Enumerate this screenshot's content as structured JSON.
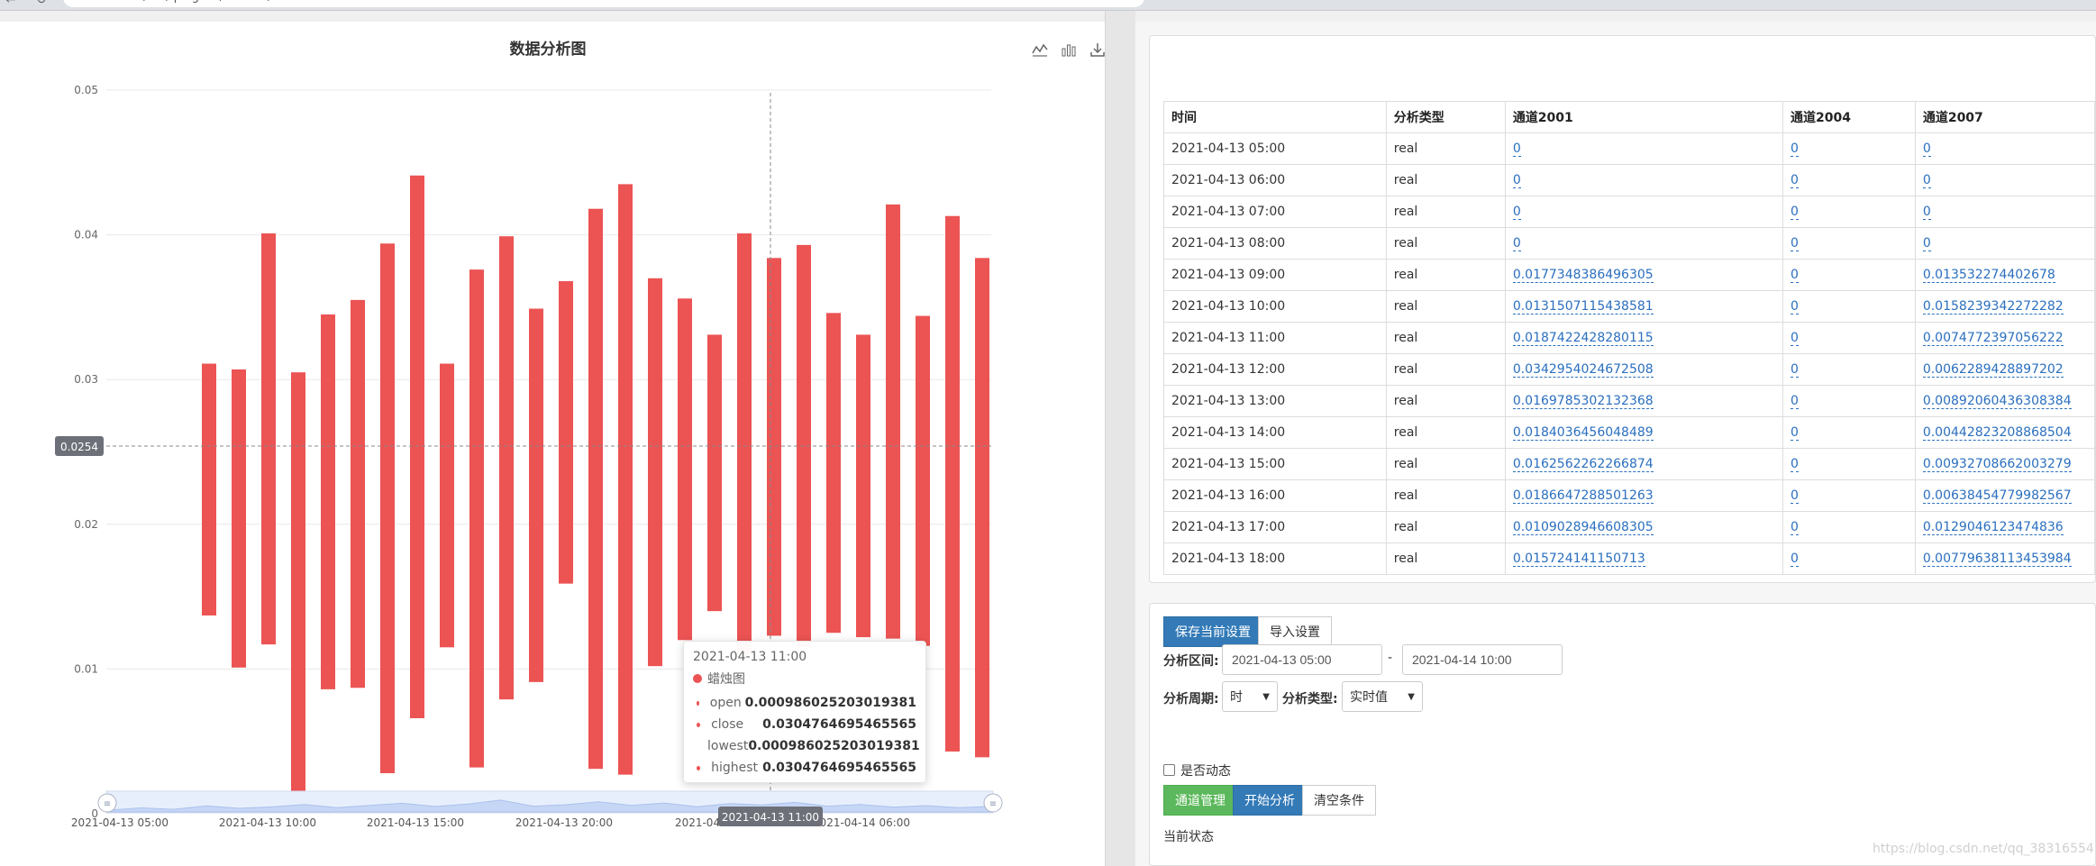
{
  "browser": {
    "url": "localhost:8 / ... / plugins / charts / ...",
    "back_glyph": "←",
    "reload_glyph": "↻"
  },
  "chart": {
    "title": "数据分析图",
    "toolbox": [
      "line-chart-icon",
      "bar-chart-icon",
      "download-icon"
    ],
    "crosshair_y_label": "0.0254",
    "crosshair_x_label": "2021-04-13 11:00",
    "zoom_handles": [
      "zoom-handle-left",
      "zoom-handle-right"
    ],
    "zero_label": "0"
  },
  "chart_data": {
    "type": "candlestick",
    "title": "数据分析图",
    "series_name": "蜡烛图",
    "ylim": [
      0,
      0.05
    ],
    "y_ticks": [
      "0.05",
      "0.04",
      "0.03",
      "0.02",
      "0.01"
    ],
    "x_tick_labels": [
      "2021-04-13 05:00",
      "2021-04-13 10:00",
      "2021-04-13 15:00",
      "2021-04-13 20:00",
      "2021-04-1",
      "2021-04-14 06:00"
    ],
    "color": "#ec5353",
    "candles": [
      {
        "low": 0.0137,
        "high": 0.0311
      },
      {
        "low": 0.0101,
        "high": 0.0307
      },
      {
        "low": 0.0117,
        "high": 0.0401
      },
      {
        "low": 0.001,
        "high": 0.0305
      },
      {
        "low": 0.0086,
        "high": 0.0345
      },
      {
        "low": 0.0087,
        "high": 0.0355
      },
      {
        "low": 0.0028,
        "high": 0.0394
      },
      {
        "low": 0.0066,
        "high": 0.0441
      },
      {
        "low": 0.0115,
        "high": 0.0311
      },
      {
        "low": 0.0032,
        "high": 0.0376
      },
      {
        "low": 0.0079,
        "high": 0.0399
      },
      {
        "low": 0.0091,
        "high": 0.0349
      },
      {
        "low": 0.0159,
        "high": 0.0368
      },
      {
        "low": 0.0031,
        "high": 0.0418
      },
      {
        "low": 0.0027,
        "high": 0.0435
      },
      {
        "low": 0.0102,
        "high": 0.037
      },
      {
        "low": 0.012,
        "high": 0.0356
      },
      {
        "low": 0.014,
        "high": 0.0331
      },
      {
        "low": 0.011,
        "high": 0.0401
      },
      {
        "low": 0.0123,
        "high": 0.0384
      },
      {
        "low": 0.0115,
        "high": 0.0393
      },
      {
        "low": 0.0125,
        "high": 0.0346
      },
      {
        "low": 0.0122,
        "high": 0.0331
      },
      {
        "low": 0.0121,
        "high": 0.0421
      },
      {
        "low": 0.0116,
        "high": 0.0344
      },
      {
        "low": 0.0043,
        "high": 0.0413
      },
      {
        "low": 0.0039,
        "high": 0.0384
      }
    ],
    "mini_series": [
      0.12,
      0.28,
      0.18,
      0.42,
      0.25,
      0.35,
      0.52,
      0.3,
      0.45,
      0.6,
      0.38,
      0.55,
      0.82,
      0.4,
      0.5,
      0.7,
      0.45,
      0.62,
      0.36,
      0.58,
      0.48,
      0.66,
      0.4,
      0.52,
      0.34,
      0.44,
      0.3,
      0.38
    ]
  },
  "tooltip": {
    "title": "2021-04-13 11:00",
    "series": "蜡烛图",
    "rows": [
      {
        "label": "open",
        "value": "0.000986025203019381"
      },
      {
        "label": "close",
        "value": "0.0304764695465565"
      },
      {
        "label": "lowest",
        "value": "0.000986025203019381"
      },
      {
        "label": "highest",
        "value": "0.0304764695465565"
      }
    ]
  },
  "table": {
    "headers": [
      "时间",
      "分析类型",
      "通道2001",
      "通道2004",
      "通道2007"
    ],
    "rows": [
      [
        "2021-04-13 05:00",
        "real",
        "0",
        "0",
        "0"
      ],
      [
        "2021-04-13 06:00",
        "real",
        "0",
        "0",
        "0"
      ],
      [
        "2021-04-13 07:00",
        "real",
        "0",
        "0",
        "0"
      ],
      [
        "2021-04-13 08:00",
        "real",
        "0",
        "0",
        "0"
      ],
      [
        "2021-04-13 09:00",
        "real",
        "0.0177348386496305",
        "0",
        "0.013532274402678"
      ],
      [
        "2021-04-13 10:00",
        "real",
        "0.0131507115438581",
        "0",
        "0.0158239342272282"
      ],
      [
        "2021-04-13 11:00",
        "real",
        "0.0187422428280115",
        "0",
        "0.0074772397056222"
      ],
      [
        "2021-04-13 12:00",
        "real",
        "0.0342954024672508",
        "0",
        "0.0062289428897202"
      ],
      [
        "2021-04-13 13:00",
        "real",
        "0.0169785302132368",
        "0",
        "0.00892060436308384"
      ],
      [
        "2021-04-13 14:00",
        "real",
        "0.0184036456048489",
        "0",
        "0.00442823208868504"
      ],
      [
        "2021-04-13 15:00",
        "real",
        "0.0162562262266874",
        "0",
        "0.00932708662003279"
      ],
      [
        "2021-04-13 16:00",
        "real",
        "0.0186647288501263",
        "0",
        "0.00638454779982567"
      ],
      [
        "2021-04-13 17:00",
        "real",
        "0.0109028946608305",
        "0",
        "0.0129046123474836"
      ],
      [
        "2021-04-13 18:00",
        "real",
        "0.015724141150713",
        "0",
        "0.00779638113453984"
      ]
    ]
  },
  "form": {
    "save_settings_label": "保存当前设置",
    "import_settings_label": "导入设置",
    "range_label": "分析区间:",
    "range_start": "2021-04-13 05:00",
    "range_separator": "-",
    "range_end": "2021-04-14 10:00",
    "period_label": "分析周期:",
    "period_value": "时",
    "type_label": "分析类型:",
    "type_value": "实时值",
    "dynamic_label": "是否动态",
    "channel_mgmt_label": "通道管理",
    "start_analysis_label": "开始分析",
    "clear_conditions_label": "清空条件",
    "status_label": "当前状态"
  },
  "watermark": "https://blog.csdn.net/qq_38316554",
  "colors": {
    "candle": "#ec5353",
    "primary": "#337ab7",
    "success": "#5cb85c",
    "link": "#2a6fbf"
  }
}
